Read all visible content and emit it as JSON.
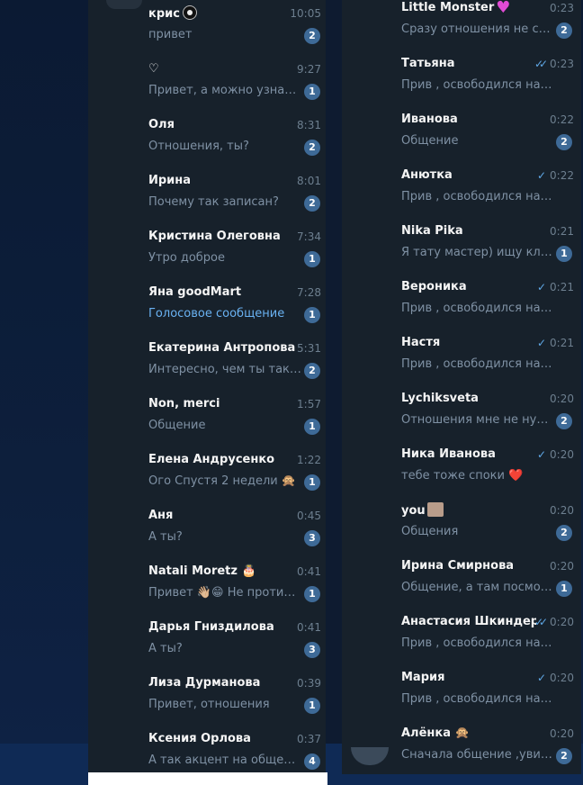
{
  "left_list": [
    {
      "name": "крис",
      "name_icon": "eye-icon",
      "time": "10:05",
      "preview": "привет",
      "unread": "2"
    },
    {
      "name": "♡",
      "time": "9:27",
      "preview": "Привет, а можно узнать ...",
      "unread": "1"
    },
    {
      "name": "Оля",
      "time": "8:31",
      "preview": "Отношения, ты?",
      "unread": "2"
    },
    {
      "name": "Ирина",
      "time": "8:01",
      "preview": "Почему так записан?",
      "unread": "2"
    },
    {
      "name": "Кристина Олеговна",
      "time": "7:34",
      "preview": "Утро доброе",
      "unread": "1"
    },
    {
      "name": "Яна goodMart",
      "time": "7:28",
      "preview": "Голосовое сообщение",
      "unread": "1",
      "preview_accent": true
    },
    {
      "name": "Екатерина Антропова",
      "time": "5:31",
      "preview": "Интересно, чем ты так б...",
      "unread": "2"
    },
    {
      "name": "Non, merci",
      "time": "1:57",
      "preview": "Общение",
      "unread": "1"
    },
    {
      "name": "Елена Андрусенко",
      "time": "1:22",
      "preview": "Ого  Спустя 2 недели 🙊",
      "unread": "1"
    },
    {
      "name": "Аня",
      "time": "0:45",
      "preview": "А ты?",
      "unread": "3"
    },
    {
      "name": "Natali Moretz 🎂",
      "time": "0:41",
      "preview": "Привет 👋🏼😁 Не против ...",
      "unread": "1"
    },
    {
      "name": "Дарья Гниздилова",
      "time": "0:41",
      "preview": "А ты?",
      "unread": "3"
    },
    {
      "name": "Лиза Дурманова",
      "time": "0:39",
      "preview": "Привет, отношения",
      "unread": "1"
    },
    {
      "name": "Ксения Орлова",
      "time": "0:37",
      "preview": "А так акцент на общение",
      "unread": "4"
    }
  ],
  "right_list": [
    {
      "name": "Little Monster",
      "name_icon": "heart-icon",
      "time": "0:23",
      "preview": "Сразу отношения не стр...",
      "unread": "2"
    },
    {
      "name": "Татьяна",
      "time": "0:23",
      "check": "double",
      "preview": "Прив , освободился наконец..."
    },
    {
      "name": "Иванова",
      "time": "0:22",
      "preview": "Общение",
      "unread": "2"
    },
    {
      "name": "Анютка",
      "time": "0:22",
      "check": "single",
      "preview": "Прив , освободился наконец..."
    },
    {
      "name": "Nika Pika",
      "time": "0:21",
      "preview": "Я тату мастер) ищу клиен...",
      "unread": "1"
    },
    {
      "name": "Вероника",
      "time": "0:21",
      "check": "single",
      "preview": "Прив , освободился наконец..."
    },
    {
      "name": "Настя",
      "time": "0:21",
      "check": "single",
      "preview": "Прив , освободился наконец..."
    },
    {
      "name": "Lychiksveta",
      "time": "0:20",
      "preview": "Отношения мне не нужны",
      "unread": "2"
    },
    {
      "name": "Ника Иванова",
      "time": "0:20",
      "check": "single",
      "preview": "тебе тоже споки ❤️"
    },
    {
      "name": "you",
      "name_icon": "photo-icon",
      "time": "0:20",
      "preview": "Общения",
      "unread": "2"
    },
    {
      "name": "Ирина Смирнова",
      "time": "0:20",
      "preview": "Общение, а там посмотр...",
      "unread": "1"
    },
    {
      "name": "Анастасия Шкиндер",
      "time": "0:20",
      "check": "double",
      "preview": "Прив , освободился наконец..."
    },
    {
      "name": "Мария",
      "time": "0:20",
      "check": "single",
      "preview": "Прив , освободился наконец..."
    },
    {
      "name": "Алёнка 🙊",
      "time": "0:20",
      "preview": "Сначала общение ,увиде...",
      "unread": "2"
    }
  ],
  "colors": {
    "panel_bg": "#17212b",
    "badge": "#3e6a97",
    "accent": "#6ab2f2",
    "check": "#5fa8e6"
  }
}
